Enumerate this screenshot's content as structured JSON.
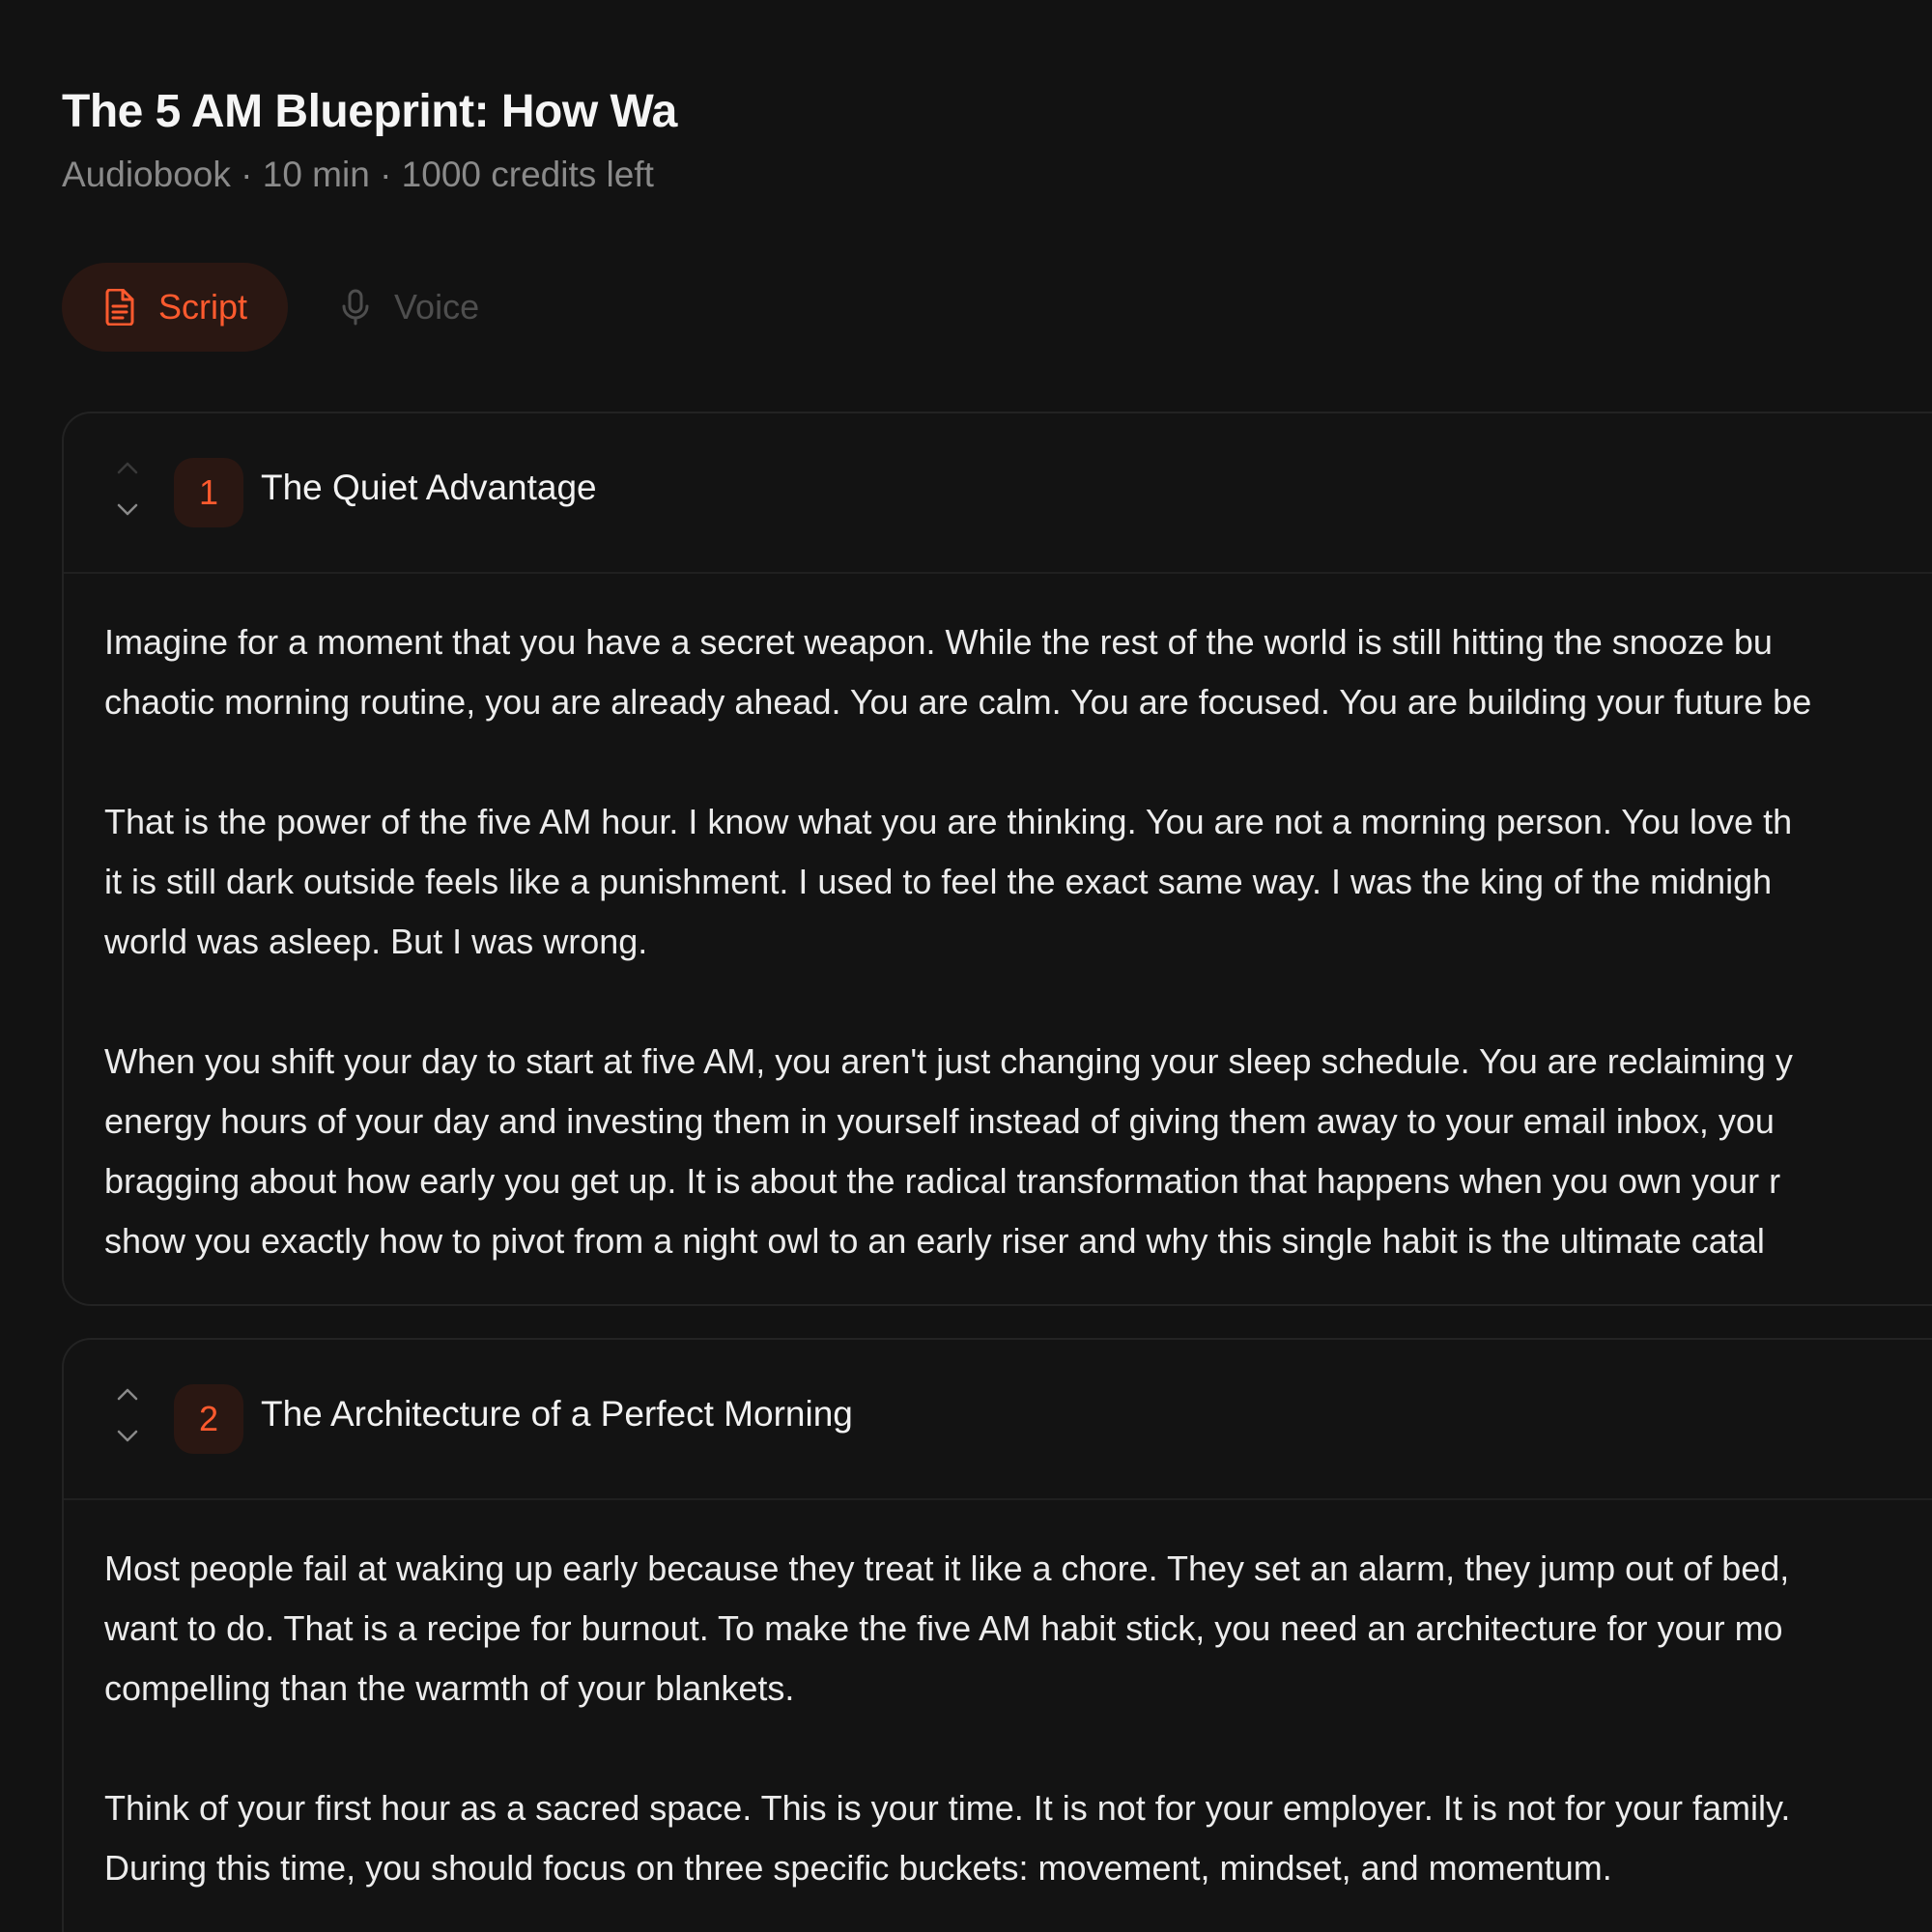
{
  "header": {
    "title": "The 5 AM Blueprint: How Wa",
    "subtitle": "Audiobook · 10 min · 1000 credits left"
  },
  "tabs": [
    {
      "label": "Script",
      "icon": "document-icon",
      "active": true
    },
    {
      "label": "Voice",
      "icon": "microphone-icon",
      "active": false
    }
  ],
  "colors": {
    "accent": "#ff5a2e",
    "accent_bg": "#2a1712",
    "background": "#121212",
    "muted": "#8a8a8a"
  },
  "sections": [
    {
      "number": "1",
      "title": "The Quiet Advantage",
      "paragraphs": [
        [
          "Imagine for a moment that you have a secret weapon. While the rest of the world is still hitting the snooze bu",
          "chaotic morning routine, you are already ahead. You are calm. You are focused. You are building your future be"
        ],
        [
          "That is the power of the five AM hour. I know what you are thinking. You are not a morning person. You love th",
          "it is still dark outside feels like a punishment. I used to feel the exact same way. I was the king of the midnigh",
          "world was asleep. But I was wrong."
        ],
        [
          "When you shift your day to start at five AM, you aren't just changing your sleep schedule. You are reclaiming y",
          "energy hours of your day and investing them in yourself instead of giving them away to your email inbox, you",
          "bragging about how early you get up. It is about the radical transformation that happens when you own your r",
          "show you exactly how to pivot from a night owl to an early riser and why this single habit is the ultimate catal"
        ]
      ]
    },
    {
      "number": "2",
      "title": "The Architecture of a Perfect Morning",
      "paragraphs": [
        [
          "Most people fail at waking up early because they treat it like a chore. They set an alarm, they jump out of bed,",
          "want to do. That is a recipe for burnout. To make the five AM habit stick, you need an architecture for your mo",
          "compelling than the warmth of your blankets."
        ],
        [
          "Think of your first hour as a sacred space. This is your time. It is not for your employer. It is not for your family.",
          "During this time, you should focus on three specific buckets: movement, mindset, and momentum."
        ]
      ]
    }
  ]
}
